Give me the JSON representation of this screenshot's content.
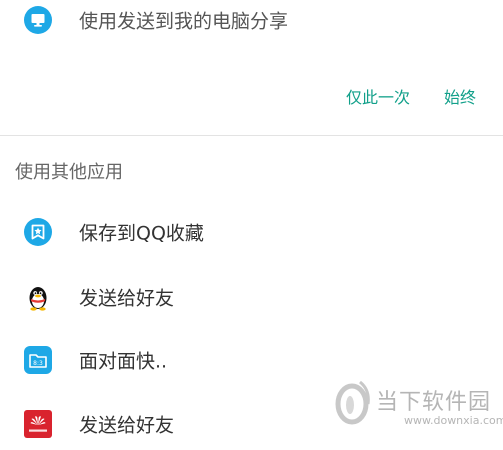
{
  "top_option": {
    "label": "使用发送到我的电脑分享",
    "icon": "monitor-icon"
  },
  "actions": {
    "just_once": "仅此一次",
    "always": "始终"
  },
  "section": {
    "title": "使用其他应用"
  },
  "apps": [
    {
      "label": "保存到QQ收藏",
      "icon": "qq-favorites-icon"
    },
    {
      "label": "发送给好友",
      "icon": "qq-penguin-icon"
    },
    {
      "label": "面对面快..",
      "icon": "face-to-face-transfer-icon"
    },
    {
      "label": "发送给好友",
      "icon": "huawei-share-icon"
    }
  ],
  "watermark": {
    "title": "当下软件园",
    "url": "www.downxia.com"
  },
  "colors": {
    "accent": "#12a08a",
    "icon_blue": "#1ea8e6",
    "huawei_red": "#d9232e"
  }
}
